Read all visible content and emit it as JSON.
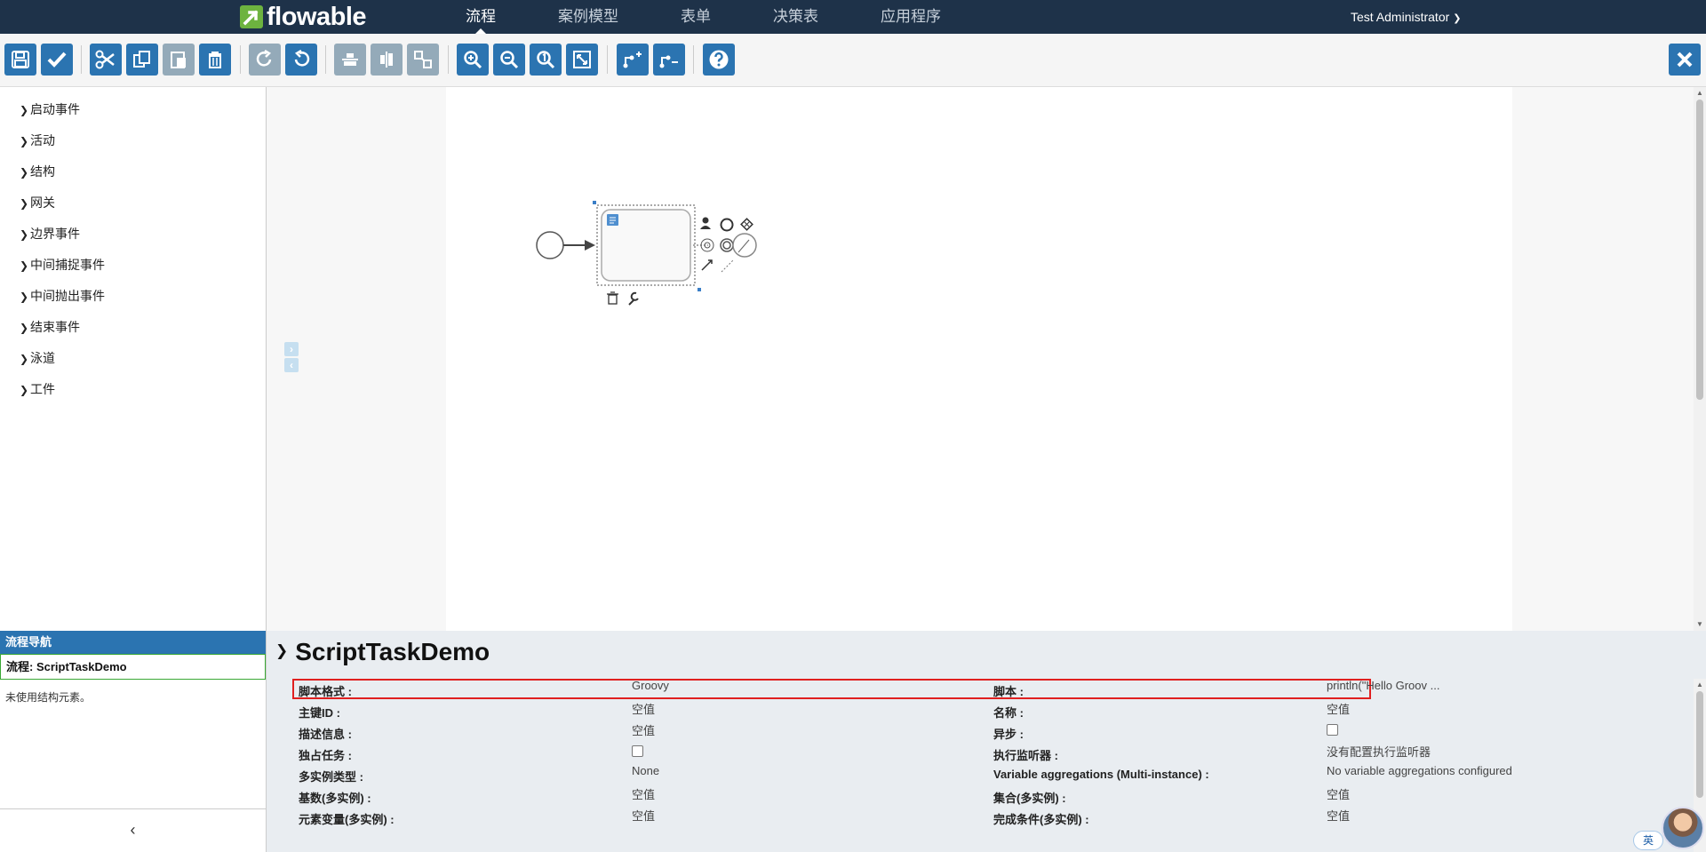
{
  "brand": {
    "name": "flowable",
    "color": "#6db33f"
  },
  "nav": {
    "items": [
      "流程",
      "案例模型",
      "表单",
      "决策表",
      "应用程序"
    ],
    "active": "流程",
    "user": "Test Administrator"
  },
  "toolbar": {
    "buttons": [
      {
        "id": "save",
        "icon": "save-icon"
      },
      {
        "id": "validate",
        "icon": "check-icon"
      },
      {
        "id": "cut",
        "icon": "scissors-icon"
      },
      {
        "id": "copy",
        "icon": "copy-icon"
      },
      {
        "id": "paste",
        "icon": "paste-icon"
      },
      {
        "id": "delete",
        "icon": "trash-icon"
      },
      {
        "id": "redo",
        "icon": "redo-icon"
      },
      {
        "id": "undo",
        "icon": "undo-icon"
      },
      {
        "id": "align-horizontal",
        "icon": "align-horizontal-icon"
      },
      {
        "id": "align-vertical",
        "icon": "align-vertical-icon"
      },
      {
        "id": "same-size",
        "icon": "same-size-icon"
      },
      {
        "id": "zoom-in",
        "icon": "zoom-in-icon"
      },
      {
        "id": "zoom-out",
        "icon": "zoom-out-icon"
      },
      {
        "id": "zoom-actual",
        "icon": "zoom-actual-icon"
      },
      {
        "id": "zoom-fit",
        "icon": "zoom-fit-icon"
      },
      {
        "id": "add-bendpoint",
        "icon": "add-bendpoint-icon"
      },
      {
        "id": "remove-bendpoint",
        "icon": "remove-bendpoint-icon"
      },
      {
        "id": "help",
        "icon": "help-icon"
      },
      {
        "id": "close",
        "icon": "close-icon"
      }
    ]
  },
  "palette": {
    "groups": [
      "启动事件",
      "活动",
      "结构",
      "网关",
      "边界事件",
      "中间捕捉事件",
      "中间抛出事件",
      "结束事件",
      "泳道",
      "工件"
    ]
  },
  "navigator": {
    "title": "流程导航",
    "process": "流程: ScriptTaskDemo",
    "empty": "未使用结构元素。"
  },
  "properties": {
    "title": "ScriptTaskDemo",
    "rows": [
      {
        "l1": "脚本格式 :",
        "v1": "Groovy",
        "l2": "脚本 :",
        "v2": "println(\"Hello Groov ..."
      },
      {
        "l1": "主键ID :",
        "v1": "空值",
        "l2": "名称 :",
        "v2": "空值"
      },
      {
        "l1": "描述信息 :",
        "v1": "空值",
        "l2": "异步 :",
        "v2": ""
      },
      {
        "l1": "独占任务 :",
        "v1": "",
        "l2": "执行监听器 :",
        "v2": "没有配置执行监听器"
      },
      {
        "l1": "多实例类型 :",
        "v1": "None",
        "l2": "Variable aggregations (Multi-instance) :",
        "v2": "No variable aggregations configured"
      },
      {
        "l1": "基数(多实例) :",
        "v1": "空值",
        "l2": "集合(多实例) :",
        "v2": "空值"
      },
      {
        "l1": "元素变量(多实例) :",
        "v1": "空值",
        "l2": "完成条件(多实例) :",
        "v2": "空值"
      }
    ]
  },
  "ime": {
    "label": "英"
  },
  "colors": {
    "nav_bg": "#1e3249",
    "button": "#2b74b1",
    "button_disabled": "#94aab9",
    "highlight": "#e02020",
    "selection_border": "#3aa835"
  }
}
